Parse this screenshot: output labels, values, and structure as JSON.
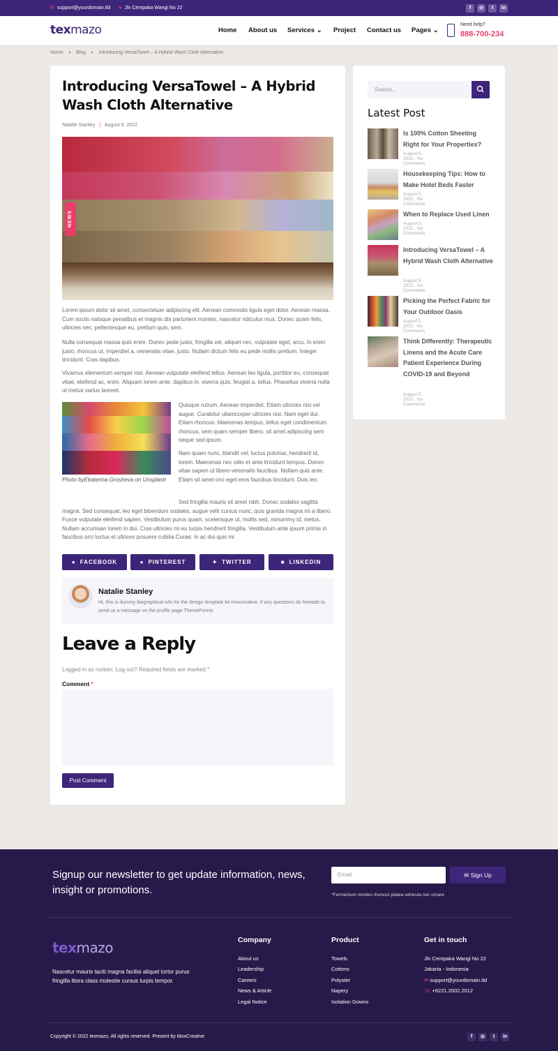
{
  "topbar": {
    "email": "support@yourdomain.tld",
    "address": "Jln Cempaka Wangi No 22",
    "social": [
      "f",
      "◎",
      "t",
      "in"
    ]
  },
  "header": {
    "logo_bold": "tex",
    "logo_light": "mazo",
    "nav": [
      "Home",
      "About us",
      "Services",
      "Project",
      "Contact us",
      "Pages"
    ],
    "help_label": "Need help?",
    "help_phone": "888-700-234"
  },
  "breadcrumb": [
    "Home",
    "Blog",
    "Introducing VersaTowel – A Hybrid Wash Cloth Alternative"
  ],
  "post": {
    "title": "Introducing VersaTowel – A Hybrid Wash Cloth Alternative",
    "author": "Natalie Stanley",
    "date": "August 5, 2022",
    "badge": "NEWS",
    "p1": "Lorem ipsum dolor sit amet, consectetuer adipiscing elit. Aenean commodo ligula eget dolor. Aenean massa. Cum sociis natoque penatibus et magnis dis parturient montes, nascetur ridiculus mus. Donec quam felis, ultricies nec, pellentesque eu, pretium quis, sem.",
    "p2": "Nulla consequat massa quis enim. Donec pede justo, fringilla vel, aliquet nec, vulputate eget, arcu. In enim justo, rhoncus ut, imperdiet a, venenatis vitae, justo. Nullam dictum felis eu pede mollis pretium. Integer tincidunt. Cras dapibus.",
    "p3": "Vivamus elementum semper nisi. Aenean vulputate eleifend tellus. Aenean leo ligula, porttitor eu, consequat vitae, eleifend ac, enim. Aliquam lorem ante, dapibus in, viverra quis, feugiat a, tellus. Phasellus viverra nulla ut metus varius laoreet.",
    "p4": "Quisque rutrum. Aenean imperdiet. Etiam ultricies nisi vel augue. Curabitur ullamcorper ultricies nisi. Nam eget dui. Etiam rhoncus. Maecenas tempus, tellus eget condimentum rhoncus, sem quam semper libero, sit amet adipiscing sem neque sed ipsum.",
    "p5": "Nam quam nunc, blandit vel, luctus pulvinar, hendrerit id, lorem. Maecenas nec odio et ante tincidunt tempus. Donec vitae sapien ut libero venenatis faucibus. Nullam quis ante. Etiam sit amet orci eget eros faucibus tincidunt. Duis leo.",
    "p6": "Sed fringilla mauris sit amet nibh. Donec sodales sagittis magna. Sed consequat, leo eget bibendum sodales, augue velit cursus nunc, quis gravida magna mi a libero. Fusce vulputate eleifend sapien. Vestibulum purus quam, scelerisque ut, mollis sed, nonummy id, metus. Nullam accumsan lorem in dui. Cras ultricies mi eu turpis hendrerit fringilla. Vestibulum ante ipsum primis in faucibus orci luctus et ultrices posuere cubilia Curae; In ac dui quis mi",
    "caption_pre": "Photo by",
    "caption_name": "Ekaterina Grosheva",
    "caption_post": " on Unsplash"
  },
  "share": [
    "FACEBOOK",
    "PINTEREST",
    "TWITTER",
    "LINKEDIN"
  ],
  "author_box": {
    "name": "Natalie Stanley",
    "bio": "Hi, this is dummy biographical info for the design template kit moxcreative. If any questions do hesitate to send us a message on the profile page ThemeForest."
  },
  "reply": {
    "heading": "Leave a Reply",
    "logged": "Logged in as rocken. Log out? Required fields are marked *",
    "comment_label": "Comment",
    "required_mark": "*",
    "button": "Post Comment"
  },
  "sidebar": {
    "search_placeholder": "Search...",
    "heading": "Latest Post",
    "posts": [
      {
        "title": "Is 100% Cotton Sheeting Right for Your Properties?",
        "meta": "August 5, 2022 . No Comments"
      },
      {
        "title": "Housekeeping Tips: How to Make Hotel Beds Faster",
        "meta": "August 5, 2022 . No Comments"
      },
      {
        "title": "When to Replace Used Linen",
        "meta": "August 5, 2022 . No Comments"
      },
      {
        "title": "Introducing VersaTowel – A Hybrid Wash Cloth Alternative",
        "meta": "August 5, 2022 . No Comments"
      },
      {
        "title": "Picking the Perfect Fabric for Your Outdoor Oasis",
        "meta": "August 5, 2022 . No Comments"
      },
      {
        "title": "Think Differently: Therapeutic Linens and the Acute Care Patient Experience During COVID-19 and Beyond",
        "meta": "August 5, 2022 . No Comments"
      }
    ]
  },
  "footer": {
    "newsletter": "Signup our newsletter to get update information, news, insight or promotions.",
    "email_placeholder": "Email",
    "signup": "Sign Up",
    "note": "*Fermentum montes rhoncus platea vehicula nec ornare",
    "logo_bold": "tex",
    "logo_light": "mazo",
    "desc": "Nascetur mauris taciti magna facilisi aliquet tortor purus fringilla litora class molestie cursus turpis tempor.",
    "company_head": "Company",
    "company": [
      "About us",
      "Leadership",
      "Careers",
      "News & Article",
      "Legal Notice"
    ],
    "product_head": "Product",
    "product": [
      "Towels",
      "Cottons",
      "Polyster",
      "Napery",
      "Isolation Gowns"
    ],
    "contact_head": "Get in touch",
    "contact": [
      "Jln Cempaka Wangi No 22",
      "Jakarta - Indonesia",
      "support@yourdomain.tld",
      "+6221.2002.2012"
    ],
    "copyright": "Copyright © 2022 texmazo, All rights reserved. Present by MoxCreative"
  }
}
